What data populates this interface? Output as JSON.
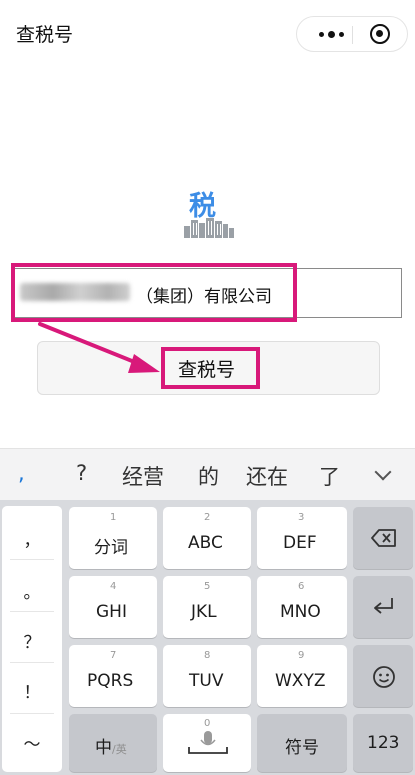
{
  "header": {
    "title": "查税号"
  },
  "search": {
    "input_suffix": "（集团）有限公司",
    "button_label": "查税号"
  },
  "logo": {
    "char": "税"
  },
  "suggestions": [
    ",",
    "?",
    "经营",
    "的",
    "还在",
    "了"
  ],
  "keyboard": {
    "punctuation": [
      "，",
      "。",
      "？",
      "！",
      "～"
    ],
    "keys": [
      {
        "num": "1",
        "label": "分词"
      },
      {
        "num": "2",
        "label": "ABC"
      },
      {
        "num": "3",
        "label": "DEF"
      },
      {
        "num": "4",
        "label": "GHI"
      },
      {
        "num": "5",
        "label": "JKL"
      },
      {
        "num": "6",
        "label": "MNO"
      },
      {
        "num": "7",
        "label": "PQRS"
      },
      {
        "num": "8",
        "label": "TUV"
      },
      {
        "num": "9",
        "label": "WXYZ"
      }
    ],
    "bottom": {
      "lang_main": "中",
      "lang_sub": "/英",
      "space_num": "0",
      "symbol": "符号",
      "numeric": "123"
    }
  },
  "colors": {
    "highlight": "#d8197a",
    "accent_blue": "#3d8de6",
    "comma_blue": "#1a76d8"
  }
}
